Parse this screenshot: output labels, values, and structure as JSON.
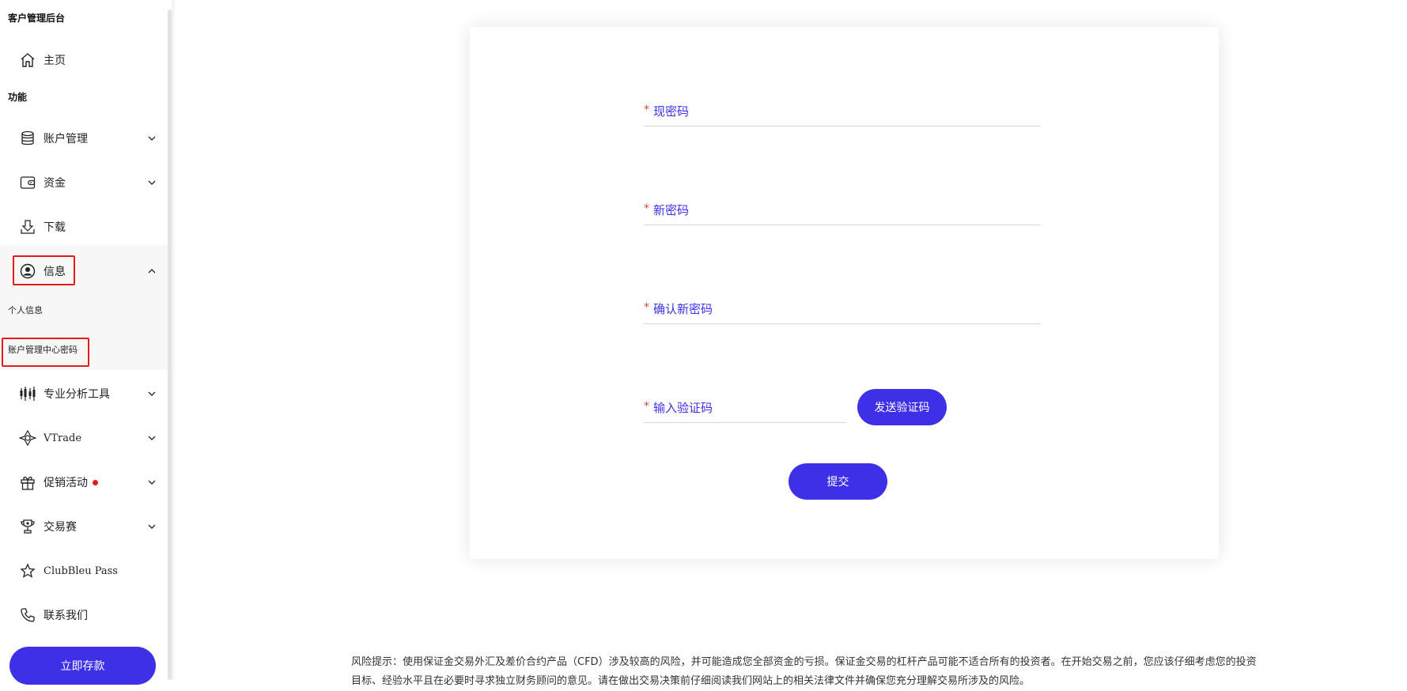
{
  "sidebar": {
    "app_title": "客户管理后台",
    "home_label": "主页",
    "section_function": "功能",
    "items": {
      "account_management": "账户管理",
      "funds": "资金",
      "download": "下载",
      "info": "信息",
      "pro_tools": "专业分析工具",
      "vtrade": "VTrade",
      "promotions": "促销活动",
      "contest": "交易赛",
      "clubbleu": "ClubBleu Pass",
      "contact": "联系我们"
    },
    "info_sub": {
      "personal_info": "个人信息",
      "account_center_password": "账户管理中心密码"
    },
    "deposit_button": "立即存款"
  },
  "form": {
    "required_mark": "*",
    "current_password": "现密码",
    "new_password": "新密码",
    "confirm_password": "确认新密码",
    "verification_code": "输入验证码",
    "send_code_button": "发送验证码",
    "submit_button": "提交"
  },
  "footer": {
    "risk_line1": "风险提示：使用保证金交易外汇及差价合约产品（CFD）涉及较高的风险，并可能造成您全部资金的亏损。保证金交易的杠杆产品可能不适合所有的投资者。在开始交易之前，您应该仔细考虑您的投资",
    "risk_line2": "目标、经验水平且在必要时寻求独立财务顾问的意见。请在做出交易决策前仔细阅读我们网站上的相关法律文件并确保您充分理解交易所涉及的风险。"
  },
  "colors": {
    "accent": "#3d30e6",
    "required": "#e84040",
    "highlight_box": "#e31b1b"
  }
}
